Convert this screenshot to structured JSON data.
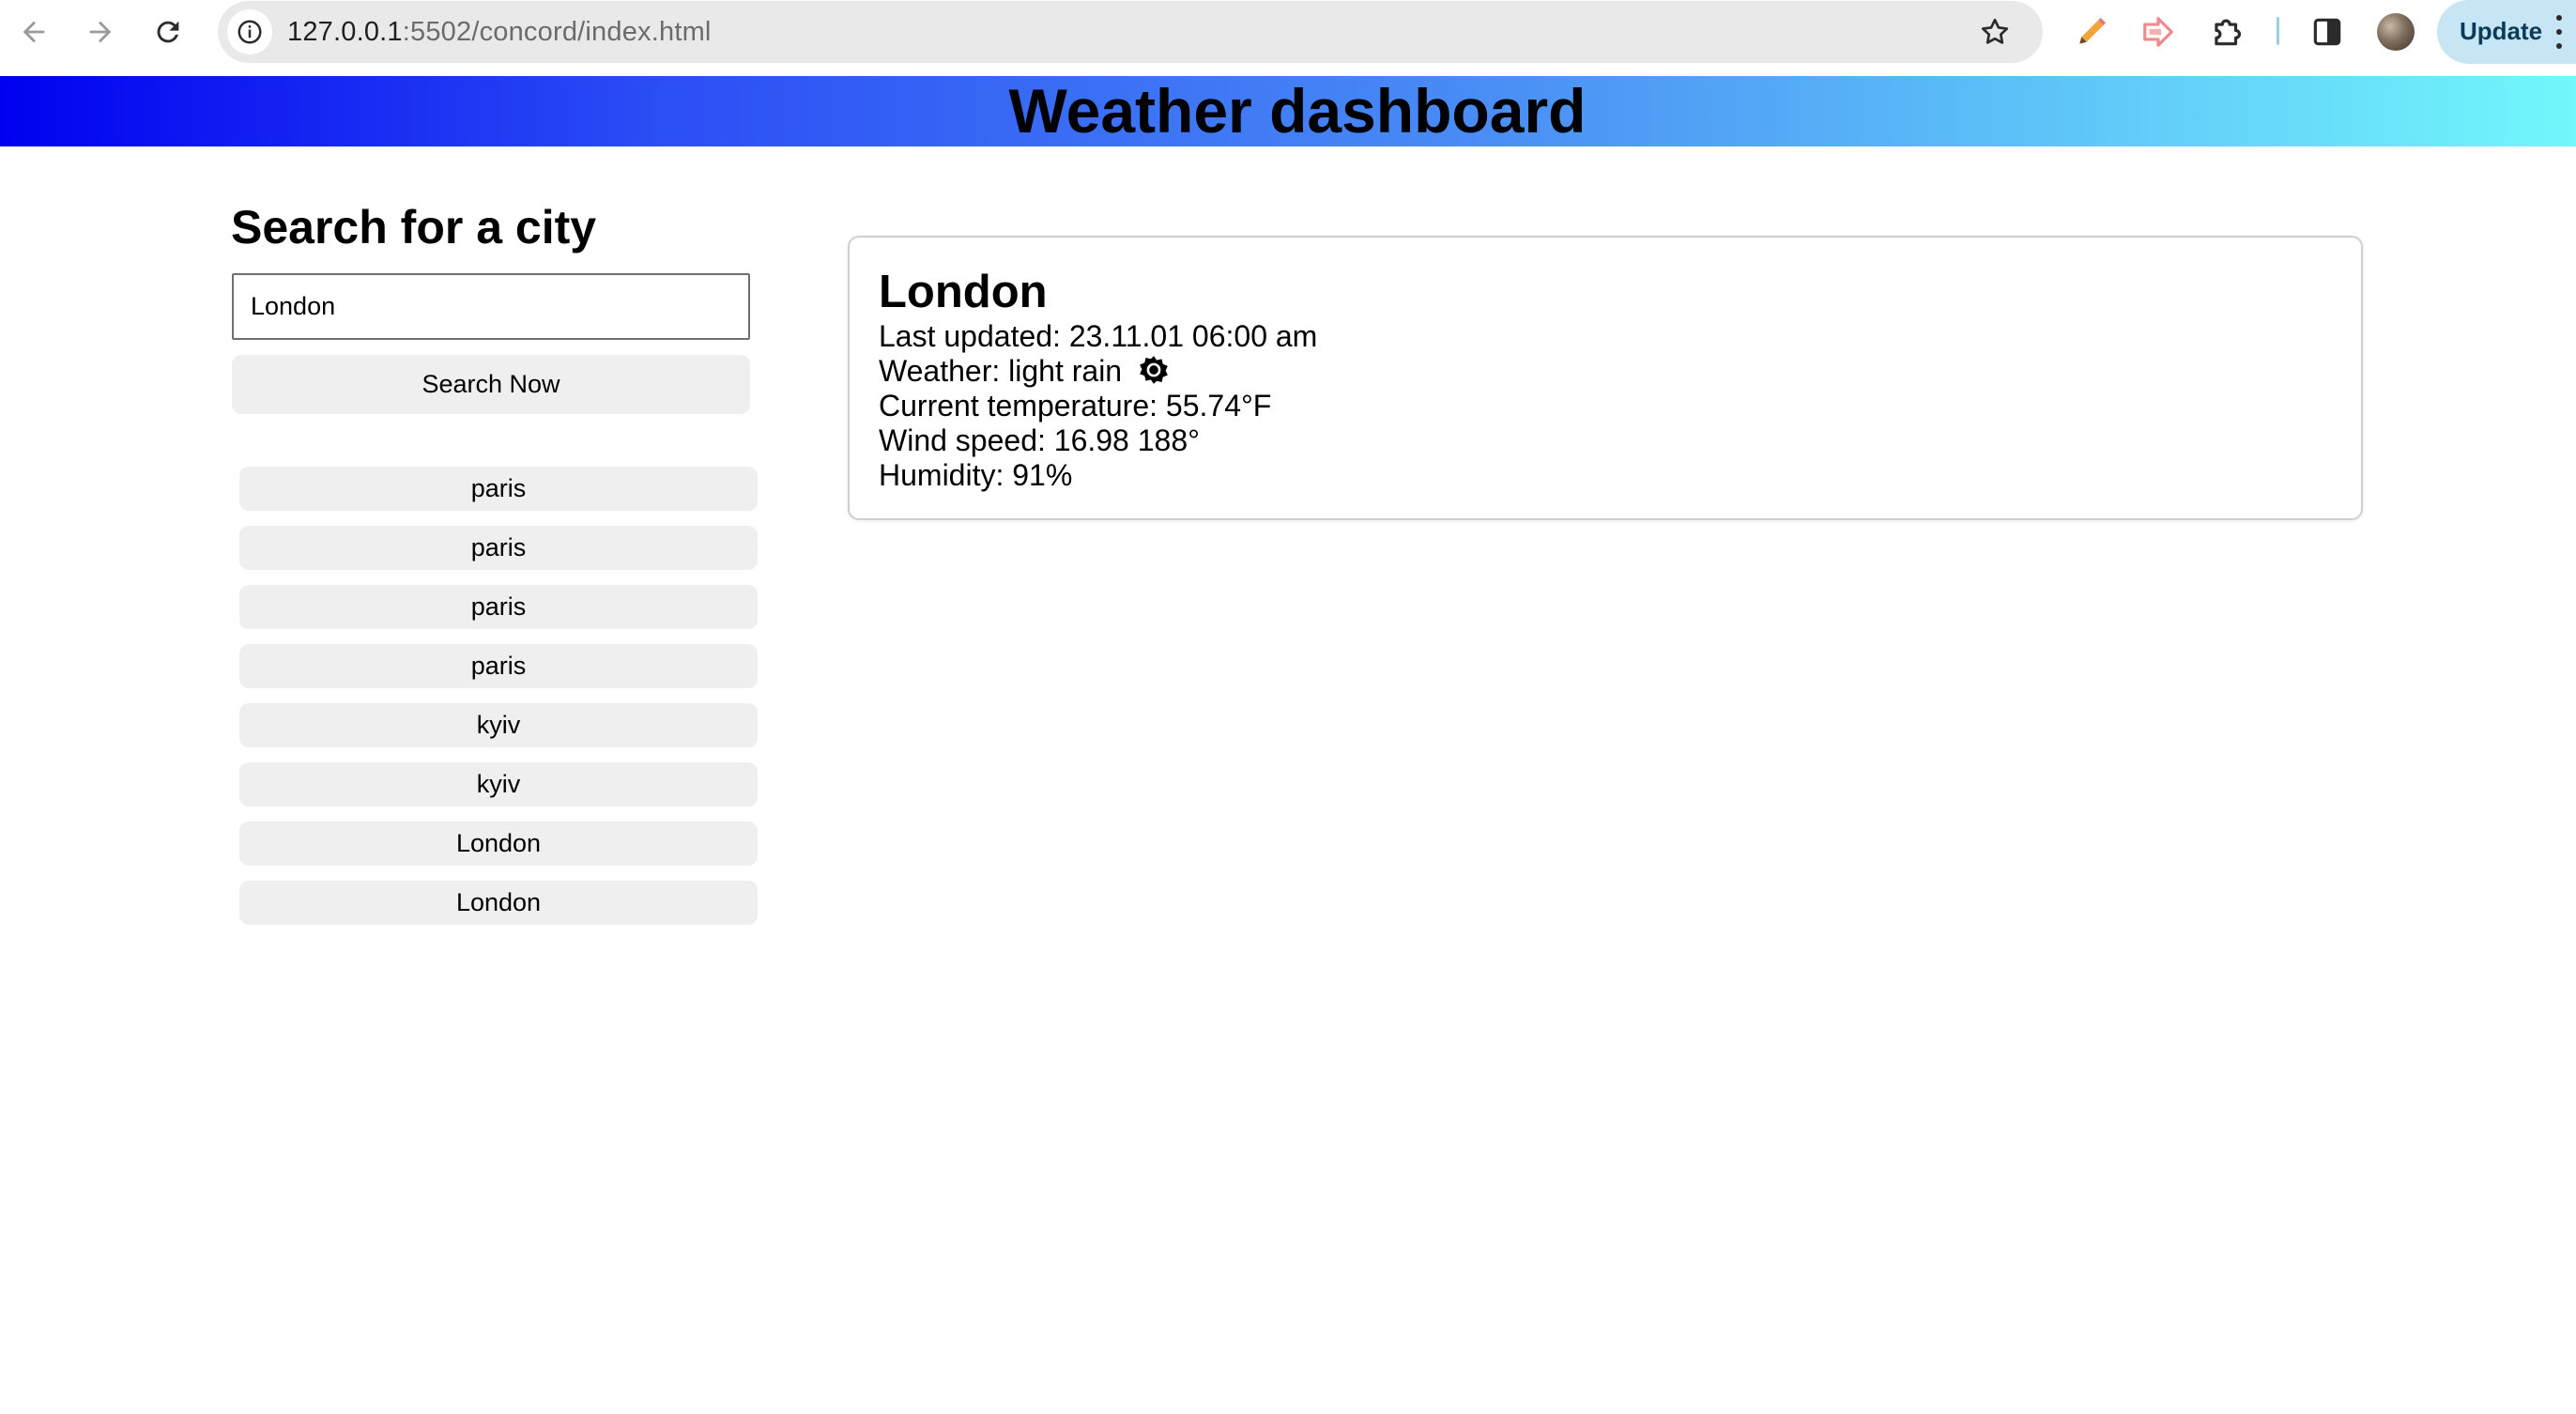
{
  "browser": {
    "url_host": "127.0.0.1",
    "url_rest": ":5502/concord/index.html",
    "update_label": "Update"
  },
  "header": {
    "title": "Weather dashboard"
  },
  "search": {
    "heading": "Search for a city",
    "input_value": "London",
    "button_label": "Search Now"
  },
  "history": {
    "items": [
      "paris",
      "paris",
      "paris",
      "paris",
      "kyiv",
      "kyiv",
      "London",
      "London"
    ]
  },
  "current": {
    "city": "London",
    "last_updated": "Last updated: 23.11.01 06:00 am",
    "weather": "Weather: light rain",
    "weather_icon": "sun-icon",
    "temperature": "Current temperature: 55.74°F",
    "wind": "Wind speed: 16.98 188°",
    "humidity": "Humidity: 91%"
  },
  "colors": {
    "banner_start": "#0000f0",
    "banner_end": "#72f7fb",
    "button_bg": "#efefef",
    "update_bg": "#c7e6f5"
  }
}
